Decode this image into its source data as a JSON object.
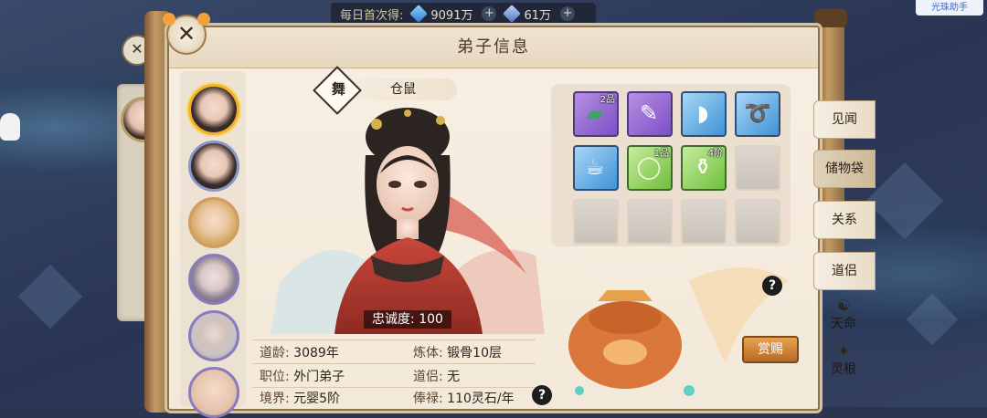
{
  "top_bar": {
    "daily_first_label": "每日首次得:",
    "resource1_value": "9091万",
    "resource2_value": "61万"
  },
  "helper_label": "光珠助手",
  "panel": {
    "title": "弟子信息"
  },
  "disciple": {
    "role_badge": "舞",
    "name": "仓鼠",
    "loyalty_label": "忠诚度: 100"
  },
  "stats": {
    "daoling_label": "道龄:",
    "daoling_value": "3089年",
    "lianti_label": "炼体:",
    "lianti_value": "锻骨10层",
    "zhiwei_label": "职位:",
    "zhiwei_value": "外门弟子",
    "daolv_label": "道侣:",
    "daolv_value": "无",
    "jingjie_label": "境界:",
    "jingjie_value": "元婴5阶",
    "fenglu_label": "俸禄:",
    "fenglu_value": "110灵石/年"
  },
  "inventory": {
    "slots": [
      {
        "icon": "jade-slip-icon",
        "rarity": "purple",
        "tag": "2品"
      },
      {
        "icon": "scroll-icon",
        "rarity": "purple",
        "tag": ""
      },
      {
        "icon": "fan-icon",
        "rarity": "blue",
        "tag": ""
      },
      {
        "icon": "ribbon-icon",
        "rarity": "blue",
        "tag": ""
      },
      {
        "icon": "teapot-icon",
        "rarity": "blue",
        "tag": ""
      },
      {
        "icon": "egg-icon",
        "rarity": "green",
        "tag": "1品"
      },
      {
        "icon": "pill-gourd-icon",
        "rarity": "green",
        "tag": "4阶"
      },
      {
        "icon": "",
        "rarity": "empty",
        "tag": ""
      },
      {
        "icon": "",
        "rarity": "empty",
        "tag": ""
      },
      {
        "icon": "",
        "rarity": "empty",
        "tag": ""
      },
      {
        "icon": "",
        "rarity": "empty",
        "tag": ""
      },
      {
        "icon": "",
        "rarity": "empty",
        "tag": ""
      }
    ]
  },
  "reward_button": "赏赐",
  "right_tabs": {
    "jianwen": "见闻",
    "chuwudai": "储物袋",
    "guanxi": "关系",
    "daolv": "道侣",
    "tianming": "天命",
    "linggen": "灵根"
  },
  "close_glyph": "✕",
  "pin_glyph": "✕",
  "help_glyph": "?",
  "colors": {
    "panel_bg": "#f5ecdf",
    "selected_avatar_border": "#f2b22c",
    "purple_rarity": "#7b4ec7",
    "blue_rarity": "#3d92d6",
    "green_rarity": "#6fbf3c"
  }
}
